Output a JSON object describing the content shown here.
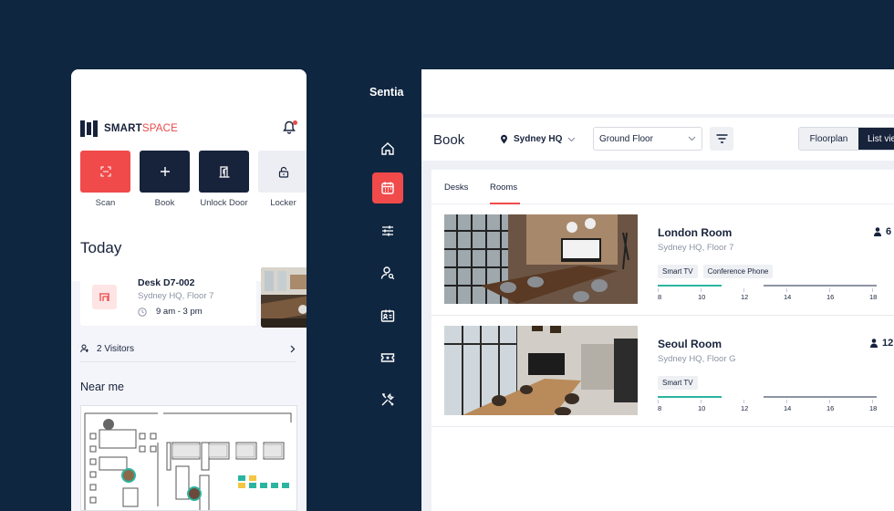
{
  "mobile": {
    "brand": {
      "bold": "SMART",
      "light": "SPACE"
    },
    "actions": [
      {
        "label": "Scan",
        "icon": "scan-icon"
      },
      {
        "label": "Book",
        "icon": "plus-icon"
      },
      {
        "label": "Unlock Door",
        "icon": "door-icon"
      },
      {
        "label": "Locker",
        "icon": "lock-icon"
      }
    ],
    "today_heading": "Today",
    "booking": {
      "title": "Desk D7-002",
      "location": "Sydney HQ, Floor 7",
      "time": "9 am - 3 pm"
    },
    "visitors": "2 Visitors",
    "near_heading": "Near me"
  },
  "sidebar": {
    "brand": "Sentia",
    "items": [
      "home-icon",
      "calendar-icon",
      "sliders-icon",
      "user-search-icon",
      "contact-card-icon",
      "ticket-icon",
      "tools-icon"
    ],
    "active_index": 1
  },
  "toolbar": {
    "title": "Book",
    "location": "Sydney HQ",
    "floor": "Ground Floor",
    "view_floorplan": "Floorplan",
    "view_list": "List view"
  },
  "tabs": [
    "Desks",
    "Rooms"
  ],
  "active_tab": "Rooms",
  "rooms": [
    {
      "name": "London Room",
      "location": "Sydney HQ, Floor 7",
      "tags": [
        "Smart TV",
        "Conference Phone"
      ],
      "capacity": "6"
    },
    {
      "name": "Seoul Room",
      "location": "Sydney HQ, Floor G",
      "tags": [
        "Smart TV"
      ],
      "capacity": "12"
    }
  ],
  "timeline_labels": [
    "8",
    "10",
    "12",
    "14",
    "16",
    "18"
  ],
  "colors": {
    "accent": "#f04a4a",
    "navy": "#17223b",
    "available": "#2bb5a0",
    "background": "#0f2640"
  }
}
